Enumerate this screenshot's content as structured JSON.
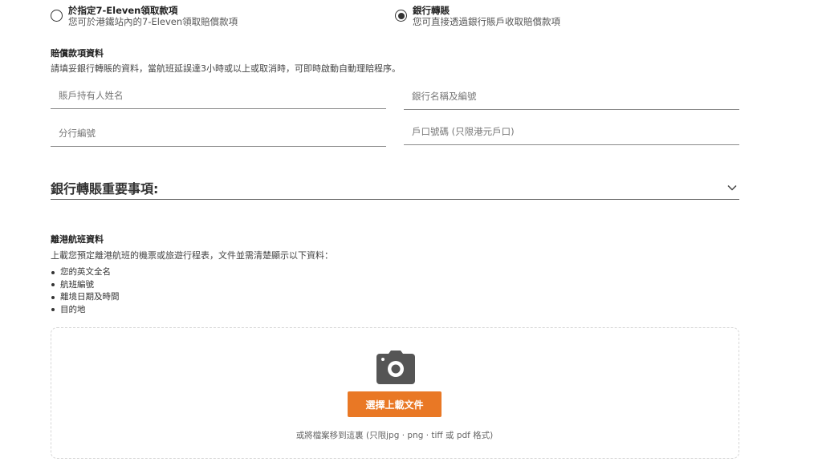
{
  "pickup_options": [
    {
      "title": "於指定7-Eleven領取款項",
      "subtitle": "您可於港鐵站內的7-Eleven領取賠償款項",
      "selected": false
    },
    {
      "title": "銀行轉賬",
      "subtitle": "您可直接透過銀行賬戶收取賠償款項",
      "selected": true
    }
  ],
  "compensation": {
    "heading": "賠償款項資料",
    "description": "請填妥銀行轉賬的資料，當航班延誤達3小時或以上或取消時，可即時啟動自動理賠程序。",
    "fields": {
      "account_holder_placeholder": "賬戶持有人姓名",
      "bank_name_placeholder": "銀行名稱及編號",
      "branch_code_placeholder": "分行編號",
      "account_number_placeholder": "戶口號碼 (只限港元戶口)"
    }
  },
  "accordion": {
    "title": "銀行轉賬重要事項:",
    "icon": "chevron-down-icon"
  },
  "flight": {
    "heading": "離港航班資料",
    "description": "上載您預定離港航班的機票或旅遊行程表，文件並需清楚顯示以下資料：",
    "requirements": [
      "您的英文全名",
      "航班編號",
      "離境日期及時間",
      "目的地"
    ]
  },
  "upload": {
    "icon": "camera-icon",
    "button_label": "選擇上載文件",
    "hint": "或將檔案移到這裏 (只限jpg · png · tiff 或 pdf 格式)"
  },
  "colors": {
    "accent": "#e97825",
    "icon_gray": "#555555"
  }
}
